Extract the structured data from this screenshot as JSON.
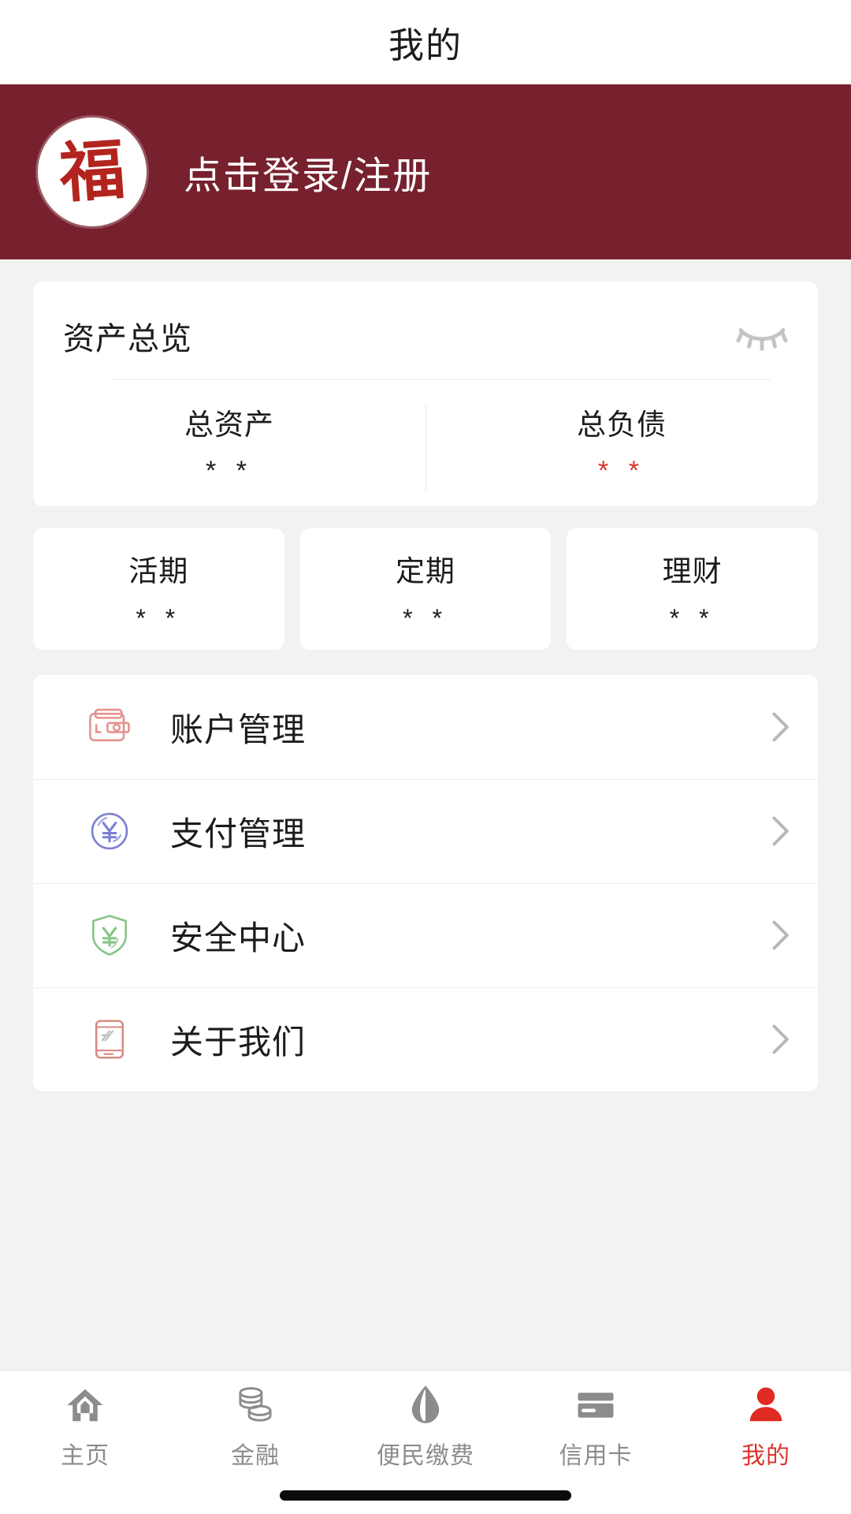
{
  "page": {
    "title": "我的",
    "background_color": "#f2f2f2"
  },
  "theme": {
    "brand_maroon": "#77202e",
    "accent_red": "#d9352c",
    "card_white": "#ffffff",
    "text_primary": "#1c1c1c",
    "text_muted": "#8c8c8c"
  },
  "profile": {
    "avatar_icon": "fu-character-logo",
    "avatar_glyph": "福",
    "login_label": "点击登录/注册"
  },
  "asset_overview": {
    "title": "资产总览",
    "visibility_icon": "eye-closed-icon",
    "figures": [
      {
        "label": "总资产",
        "value": "* *",
        "color": "#1c1c1c"
      },
      {
        "label": "总负债",
        "value": "* *",
        "color": "#d9352c"
      }
    ]
  },
  "stat_cards": [
    {
      "label": "活期",
      "value": "* *"
    },
    {
      "label": "定期",
      "value": "* *"
    },
    {
      "label": "理财",
      "value": "* *"
    }
  ],
  "menu": {
    "items": [
      {
        "label": "账户管理",
        "icon": "wallet-icon",
        "icon_color": "#e4938f",
        "chevron": "chevron-right-icon"
      },
      {
        "label": "支付管理",
        "icon": "yen-circle-icon",
        "icon_color": "#7b7fd4",
        "chevron": "chevron-right-icon"
      },
      {
        "label": "安全中心",
        "icon": "shield-yen-icon",
        "icon_color": "#86c486",
        "chevron": "chevron-right-icon"
      },
      {
        "label": "关于我们",
        "icon": "document-icon",
        "icon_color": "#d98b82",
        "chevron": "chevron-right-icon"
      }
    ]
  },
  "tabbar": {
    "items": [
      {
        "label": "主页",
        "icon": "home-icon",
        "active": false
      },
      {
        "label": "金融",
        "icon": "coins-icon",
        "active": false
      },
      {
        "label": "便民缴费",
        "icon": "water-drop-icon",
        "active": false
      },
      {
        "label": "信用卡",
        "icon": "credit-card-icon",
        "active": false
      },
      {
        "label": "我的",
        "icon": "person-icon",
        "active": true
      }
    ]
  }
}
